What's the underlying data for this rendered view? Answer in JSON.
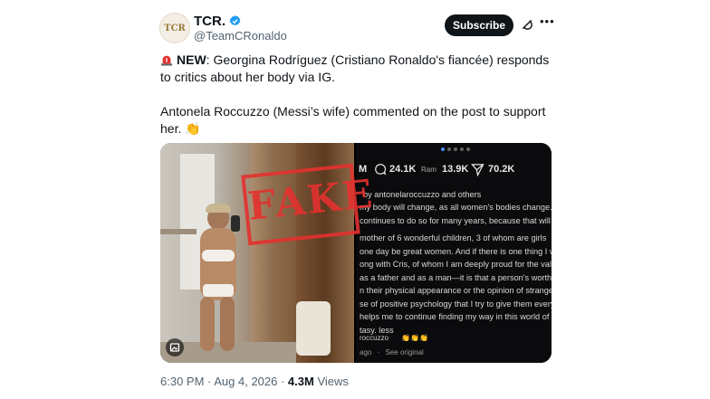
{
  "header": {
    "avatar_text": "TCR",
    "name": "TCR.",
    "handle": "@TeamCRonaldo",
    "subscribe_label": "Subscribe",
    "more_label": "•••"
  },
  "tweet": {
    "new_label": "NEW",
    "line1": ": Georgina Rodríguez (Cristiano Ronaldo's fiancée) responds to critics about her body via IG.",
    "line2": "Antonela Roccuzzo (Messi’s wife) commented on the post to support her.",
    "clap": "👏"
  },
  "media": {
    "stamp": "FAKE",
    "stats": {
      "views": "24.1K",
      "reposts": "13.9K",
      "shares": "70.2K",
      "left_initial": "M",
      "reposts_prefix": "Ram"
    },
    "liked_by": "by antonelaroccuzzo and others",
    "caption_lines": [
      "my body will change, as all women's bodies change. A",
      "continues to do so for many years, because that will me",
      "",
      "mother of 6 wonderful children, 3 of whom are girls",
      "one day be great women. And if there is one thing I want",
      "ong with Cris, of whom I am deeply proud for the values he",
      "as a father and as a man—it is that a person's worth can nev",
      "n their physical appearance or the opinion of strangers",
      "se of positive psychology that I try to give them every",
      "helps me to continue finding my way in this world of s",
      "tasy. less"
    ],
    "comment_user": "roccuzzo",
    "comment_emoji": "👏👏👏",
    "ago": "ago",
    "see_original": "See original"
  },
  "meta": {
    "time": "6:30 PM · Aug 4, 2026 · ",
    "views_count": "4.3M",
    "views_label": " Views"
  },
  "colors": {
    "accent": "#1d9bf0",
    "stamp": "#e4312f",
    "text": "#0f1419",
    "muted": "#536471"
  }
}
